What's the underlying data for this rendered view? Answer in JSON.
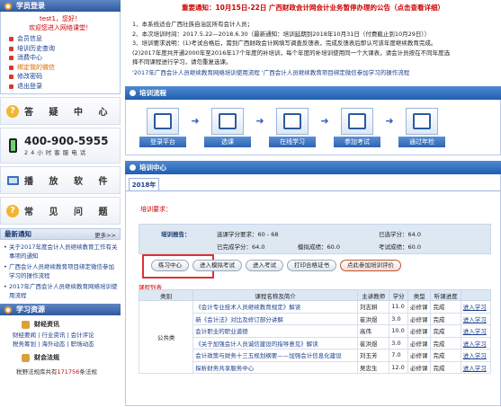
{
  "sidebar": {
    "login_title": "学员登录",
    "greeting": "test1，您好！",
    "welcome": "欢迎您进入网络课堂！",
    "menu": [
      {
        "label": "会员信息"
      },
      {
        "label": "培训历史查询"
      },
      {
        "label": "消费中心"
      },
      {
        "label": "绑定我的微信"
      },
      {
        "label": "修改密码"
      },
      {
        "label": "退出登录"
      }
    ],
    "qa_label": "答 疑 中 心",
    "phone_number": "400-900-5955",
    "phone_hours": "24小时客服电话",
    "software_label": "播 放 软 件",
    "faq_label": "常 见 问 题",
    "notice_title": "最新通知",
    "notice_more": "更多>>",
    "notices": [
      "关于2017年度会计人员继续教育工作有关事项的通知",
      "广西会计人员继续教育项目绑定微信参加学习的操作流程",
      "2017年广西会计人员继续教育网络培训使用流程"
    ],
    "resources_title": "学习资源",
    "finance_info": "财经资讯",
    "finance_links_1": "财经要闻 | 行业资讯 | 会计评论",
    "finance_links_2": "税务筹划 | 海外动态 | 职场动态",
    "finance_law": "财会法规",
    "law_count_prefix": "税野法规库共有",
    "law_count": "171756",
    "law_count_suffix": "条法规"
  },
  "main": {
    "top_notice": "重要通知：10月15日-22日 广西财政会计网会计业务暂停办理的公告（点击查看详细）",
    "intro_lines": [
      "1、本系统适合广西壮族自治区所有会计人员；",
      "2、本次培训时间：2017.5.22—2018.6.30（最新通知：培训延期到2018年10月31日（付费截止到10月29日））",
      "3、培训要求说明：(1)考试合格后，需到广西财政会计网填写调查反馈表，完成反馈表后即认可该年度继续教育完成。",
      "(2)2017年度共开通2000年至2016年17个年度的补培训，每个年度的补培训使用同一个大课表，请会计员按在不同年度选",
      "择不同课程进行学习，请勿重复选课。"
    ],
    "intro_red": "（最新通知：培训延期到2018年10月31日（付费截止到10月29日））",
    "intro_link_1": "'2017年广西会计人员继续教育网络培训使用流程",
    "intro_link_2": "'广西会计人员继续教育项目绑定微信参加学习的操作流程",
    "flow_title": "培训流程",
    "flow_steps": [
      {
        "label": "登录平台"
      },
      {
        "label": "选课"
      },
      {
        "label": "在线学习"
      },
      {
        "label": "参加考试"
      },
      {
        "label": "通过年检"
      }
    ],
    "center_title": "培训中心",
    "year_tab": "2018年",
    "requirement_label": "培训要求：",
    "report": {
      "label": "培训报告：",
      "score_total": "选课学分要求：60 - 68",
      "score_selected": "已选学分：64.0",
      "completed": "已完成学分：64.0",
      "mock": "模拟成绩：60.0",
      "exam": "考试成绩：60.0",
      "assess": "已选学分：64.0"
    },
    "buttons": {
      "practice": "练习中心",
      "mock_exam": "进入模拟考试",
      "exam": "进入考试",
      "print_cert": "打印合格证书",
      "evaluate": "点此参加培训评价"
    },
    "course_list_label": "课程列表",
    "table_headers": [
      "类别",
      "课程名称及简介",
      "主讲教师",
      "学分",
      "类型",
      "听课进度",
      ""
    ],
    "category": "公共类",
    "courses": [
      {
        "name": "《会计专业技术人员继续教育规定》解读",
        "teacher": "刘志耕",
        "credit": "11.0",
        "type": "必修课",
        "progress": "完成",
        "action": "进入学习"
      },
      {
        "name": "新《会计法》对比及修订部分讲解",
        "teacher": "崔洪煜",
        "credit": "3.0",
        "type": "必修课",
        "progress": "完成",
        "action": "进入学习"
      },
      {
        "name": "会计职业的职业道德",
        "teacher": "高伟",
        "credit": "10.0",
        "type": "必修课",
        "progress": "完成",
        "action": "进入学习"
      },
      {
        "name": "《关于加强会计人员诚信建设的指导意见》解读",
        "teacher": "崔洪煜",
        "credit": "3.0",
        "type": "必修课",
        "progress": "完成",
        "action": "进入学习"
      },
      {
        "name": "会计政策与财务十三五规划纲要——加强会计信息化建设",
        "teacher": "刘玉芳",
        "credit": "7.0",
        "type": "必修课",
        "progress": "完成",
        "action": "进入学习"
      },
      {
        "name": "探析财务共享服务中心",
        "teacher": "吴忠生",
        "credit": "12.0",
        "type": "必修课",
        "progress": "完成",
        "action": "进入学习"
      }
    ]
  }
}
